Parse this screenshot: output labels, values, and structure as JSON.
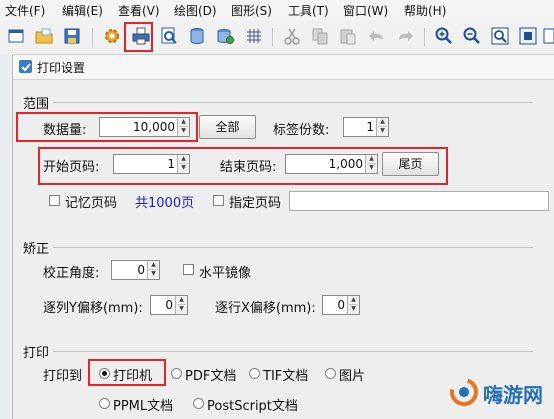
{
  "menu": {
    "items": [
      "文件(F)",
      "编辑(E)",
      "查看(V)",
      "绘图(D)",
      "图形(S)",
      "工具(T)",
      "窗口(W)",
      "帮助(H)"
    ]
  },
  "toolbar": {
    "icons": [
      "new-file-icon",
      "open-folder-icon",
      "save-icon",
      "settings-gear-icon",
      "print-icon",
      "print-preview-icon",
      "database-icon",
      "database-settings-icon",
      "grid-icon",
      "cut-icon",
      "copy-icon",
      "paste-icon",
      "undo-icon",
      "redo-icon",
      "zoom-in-icon",
      "zoom-out-icon",
      "zoom-fit-icon",
      "zoom-actual-icon"
    ],
    "highlighted": "print-icon"
  },
  "dialog": {
    "title": "打印设置",
    "range": {
      "group_label": "范围",
      "data_count_label": "数据量:",
      "data_count_value": "10,000",
      "all_button": "全部",
      "copies_label": "标签份数:",
      "copies_value": "1",
      "start_page_label": "开始页码:",
      "start_page_value": "1",
      "end_page_label": "结束页码:",
      "end_page_value": "1,000",
      "last_page_button": "尾页",
      "remember_page_label": "记忆页码",
      "total_pages_text": "共1000页",
      "specify_page_label": "指定页码",
      "specify_page_value": ""
    },
    "correction": {
      "group_label": "矫正",
      "angle_label": "校正角度:",
      "angle_value": "0",
      "mirror_label": "水平镜像",
      "col_offset_label": "逐列Y偏移(mm):",
      "col_offset_value": "0",
      "row_offset_label": "逐行X偏移(mm):",
      "row_offset_value": "0"
    },
    "print": {
      "group_label": "打印",
      "print_to_label": "打印到",
      "options": [
        "打印机",
        "PDF文档",
        "TIF文档",
        "图片",
        "PPML文档",
        "PostScript文档"
      ],
      "selected": "打印机"
    }
  },
  "watermark": {
    "text": "嗨游网"
  },
  "colors": {
    "highlight_red": "#e2242b",
    "link_blue": "#1a1acc",
    "watermark_orange": "#e8731a",
    "watermark_blue": "#2470b8"
  }
}
